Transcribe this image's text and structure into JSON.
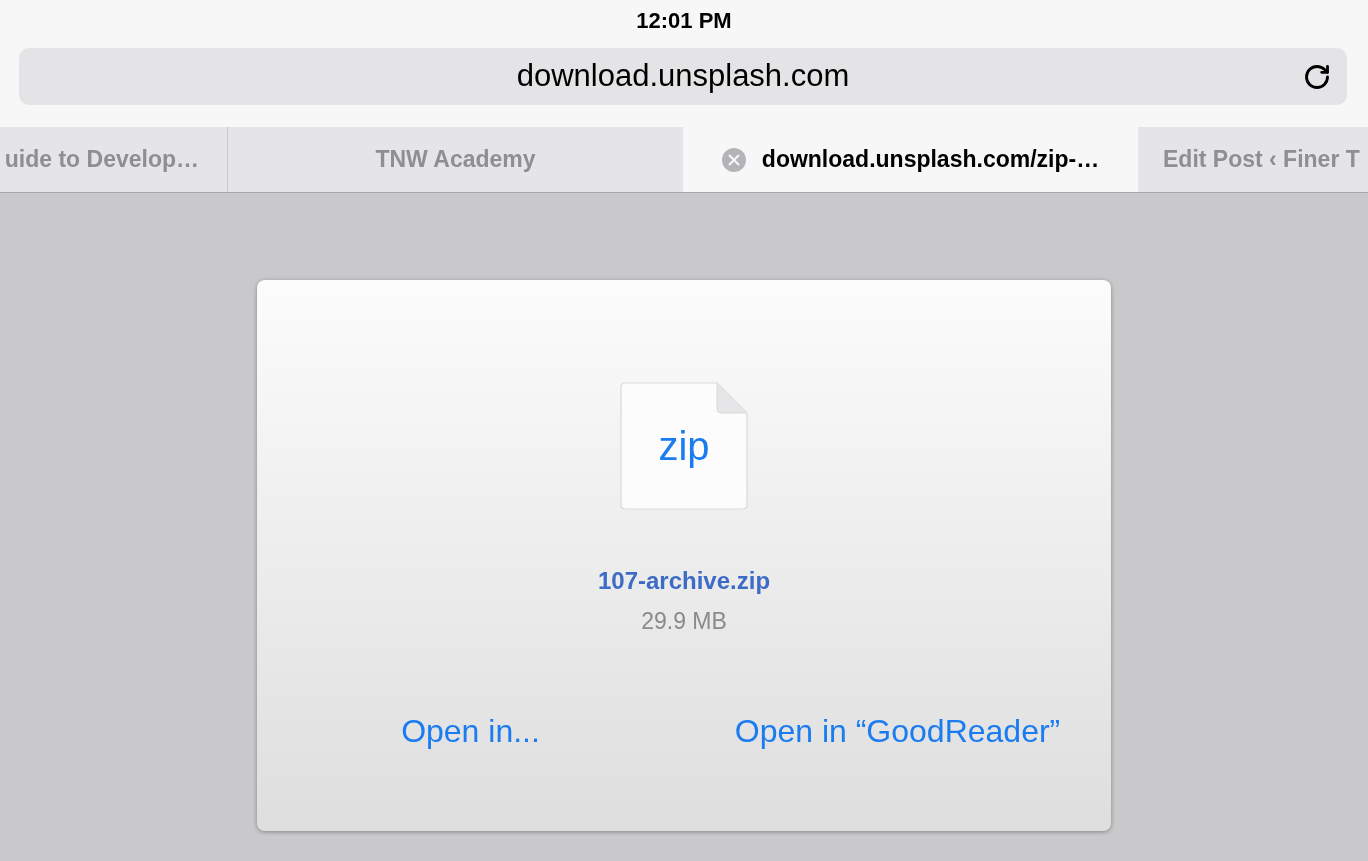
{
  "status_bar": {
    "time": "12:01 PM"
  },
  "address_bar": {
    "url": "download.unsplash.com"
  },
  "tabs": [
    {
      "title": "uide to Develop…",
      "selected": false
    },
    {
      "title": "TNW Academy",
      "selected": false
    },
    {
      "title": "download.unsplash.com/zip-…",
      "selected": true
    },
    {
      "title": "Edit Post ‹ Finer T",
      "selected": false
    }
  ],
  "download": {
    "file_type": "zip",
    "file_name": "107-archive.zip",
    "file_size": "29.9 MB",
    "actions": [
      {
        "label": "Open in..."
      },
      {
        "label": "Open in “GoodReader”"
      }
    ]
  }
}
